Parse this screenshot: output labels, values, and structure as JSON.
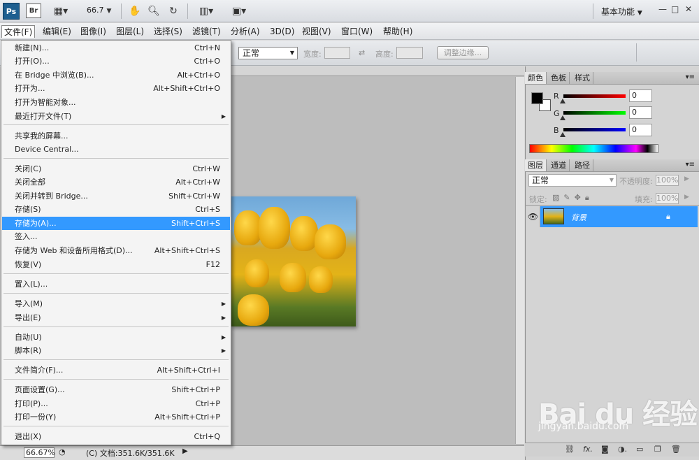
{
  "appbar": {
    "ps_logo": "Ps",
    "br_logo": "Br",
    "zoom": "66.7",
    "workspace": "基本功能",
    "win_min": "—",
    "win_max": "□",
    "win_close": "✕"
  },
  "menubar": {
    "items": [
      "文件(F)",
      "编辑(E)",
      "图像(I)",
      "图层(L)",
      "选择(S)",
      "滤镜(T)",
      "分析(A)",
      "3D(D)",
      "视图(V)",
      "窗口(W)",
      "帮助(H)"
    ]
  },
  "options": {
    "style": "正常",
    "width_label": "宽度:",
    "height_label": "高度:",
    "refine_button": "调整边缘..."
  },
  "file_menu": {
    "items": [
      {
        "label": "新建(N)...",
        "shortcut": "Ctrl+N"
      },
      {
        "label": "打开(O)...",
        "shortcut": "Ctrl+O"
      },
      {
        "label": "在 Bridge 中浏览(B)...",
        "shortcut": "Alt+Ctrl+O"
      },
      {
        "label": "打开为...",
        "shortcut": "Alt+Shift+Ctrl+O"
      },
      {
        "label": "打开为智能对象...",
        "shortcut": ""
      },
      {
        "label": "最近打开文件(T)",
        "shortcut": "",
        "submenu": true
      },
      {
        "label": "共享我的屏幕...",
        "shortcut": ""
      },
      {
        "label": "Device Central...",
        "shortcut": ""
      },
      {
        "label": "关闭(C)",
        "shortcut": "Ctrl+W"
      },
      {
        "label": "关闭全部",
        "shortcut": "Alt+Ctrl+W"
      },
      {
        "label": "关闭并转到 Bridge...",
        "shortcut": "Shift+Ctrl+W"
      },
      {
        "label": "存储(S)",
        "shortcut": "Ctrl+S"
      },
      {
        "label": "存储为(A)...",
        "shortcut": "Shift+Ctrl+S",
        "highlighted": true
      },
      {
        "label": "签入...",
        "shortcut": ""
      },
      {
        "label": "存储为 Web 和设备所用格式(D)...",
        "shortcut": "Alt+Shift+Ctrl+S"
      },
      {
        "label": "恢复(V)",
        "shortcut": "F12"
      },
      {
        "label": "置入(L)...",
        "shortcut": ""
      },
      {
        "label": "导入(M)",
        "shortcut": "",
        "submenu": true
      },
      {
        "label": "导出(E)",
        "shortcut": "",
        "submenu": true
      },
      {
        "label": "自动(U)",
        "shortcut": "",
        "submenu": true
      },
      {
        "label": "脚本(R)",
        "shortcut": "",
        "submenu": true
      },
      {
        "label": "文件简介(F)...",
        "shortcut": "Alt+Shift+Ctrl+I"
      },
      {
        "label": "页面设置(G)...",
        "shortcut": "Shift+Ctrl+P"
      },
      {
        "label": "打印(P)...",
        "shortcut": "Ctrl+P"
      },
      {
        "label": "打印一份(Y)",
        "shortcut": "Alt+Shift+Ctrl+P"
      },
      {
        "label": "退出(X)",
        "shortcut": "Ctrl+Q"
      }
    ]
  },
  "color_panel": {
    "tabs": [
      "颜色",
      "色板",
      "样式"
    ],
    "r_label": "R",
    "g_label": "G",
    "b_label": "B",
    "r": "0",
    "g": "0",
    "b": "0"
  },
  "layers_panel": {
    "tabs": [
      "图层",
      "通道",
      "路径"
    ],
    "blend_mode": "正常",
    "opacity_label": "不透明度:",
    "opacity": "100%",
    "lock_label": "锁定:",
    "fill_label": "填充:",
    "fill": "100%",
    "layer_name": "背景"
  },
  "status": {
    "zoom": "66.67%",
    "doc": "(C) 文档:351.6K/351.6K"
  },
  "watermark": {
    "main": "Bai du 经验",
    "url": "jingyan.baidu.com"
  },
  "colors": {
    "highlight": "#3399ff",
    "ps_blue": "#1d5e8f"
  }
}
